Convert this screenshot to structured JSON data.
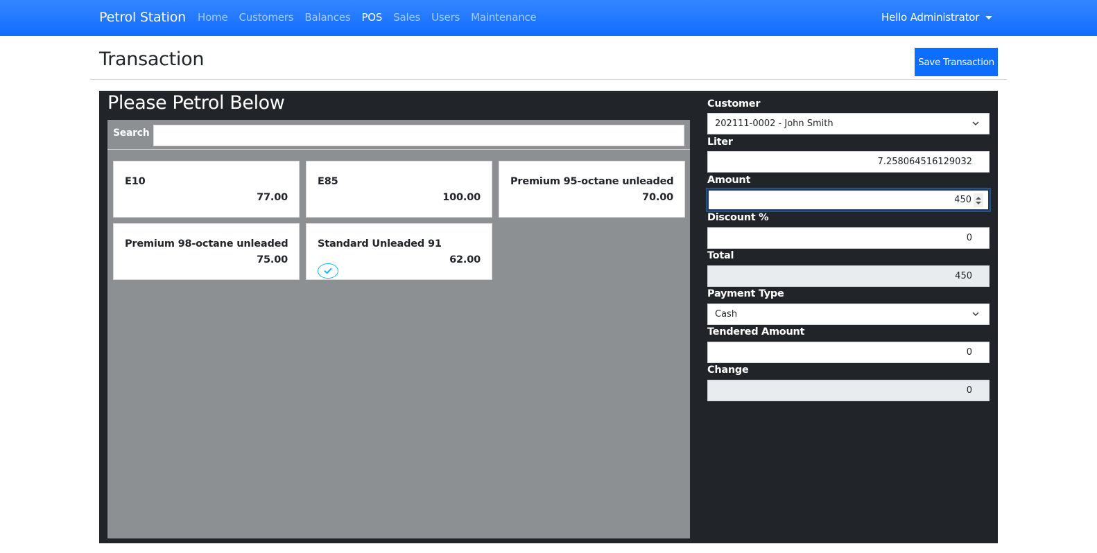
{
  "navbar": {
    "brand": "Petrol Station",
    "links": [
      {
        "label": "Home",
        "active": false
      },
      {
        "label": "Customers",
        "active": false
      },
      {
        "label": "Balances",
        "active": false
      },
      {
        "label": "POS",
        "active": true
      },
      {
        "label": "Sales",
        "active": false
      },
      {
        "label": "Users",
        "active": false
      },
      {
        "label": "Maintenance",
        "active": false
      }
    ],
    "user_menu": "Hello Administrator",
    "user_menu_icon": "caret-down-icon"
  },
  "header": {
    "title": "Transaction",
    "save_label": "Save Transaction"
  },
  "products_panel": {
    "title": "Please Petrol Below",
    "search_label": "Search",
    "search_value": "",
    "products": [
      {
        "name": "E10",
        "price": "77.00",
        "selected": false
      },
      {
        "name": "E85",
        "price": "100.00",
        "selected": false
      },
      {
        "name": "Premium 95-octane unleaded",
        "price": "70.00",
        "selected": false
      },
      {
        "name": "Premium 98-octane unleaded",
        "price": "75.00",
        "selected": false
      },
      {
        "name": "Standard Unleaded 91",
        "price": "62.00",
        "selected": true
      }
    ],
    "selected_icon": "check-circle-icon"
  },
  "form": {
    "customer": {
      "label": "Customer",
      "value": "202111-0002 - John Smith"
    },
    "liter": {
      "label": "Liter",
      "value": "7.258064516129032"
    },
    "amount": {
      "label": "Amount",
      "value": "450"
    },
    "discount": {
      "label": "Discount %",
      "value": "0"
    },
    "total": {
      "label": "Total",
      "value": "450"
    },
    "payment_type": {
      "label": "Payment Type",
      "value": "Cash"
    },
    "tendered": {
      "label": "Tendered Amount",
      "value": "0"
    },
    "change": {
      "label": "Change",
      "value": "0"
    }
  },
  "colors": {
    "navbar": "#116dff",
    "primary_button": "#0d6efd",
    "panel_dark": "#212529",
    "product_area": "#8c9093",
    "check_accent": "#1ab5e8"
  }
}
